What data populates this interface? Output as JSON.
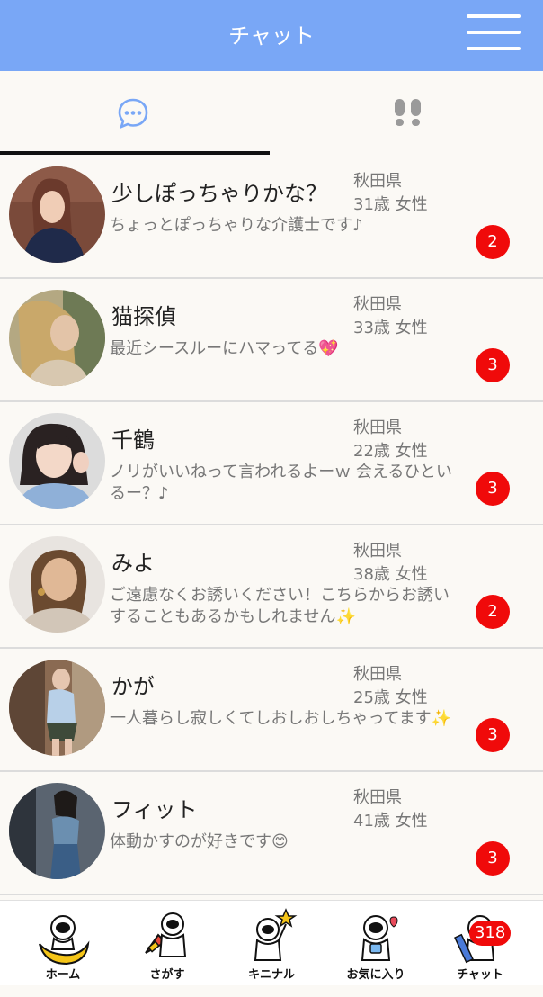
{
  "header": {
    "title": "チャット"
  },
  "tabs": [
    {
      "icon": "chat-bubble-icon"
    },
    {
      "icon": "footprints-icon"
    }
  ],
  "colors": {
    "header_bg": "#79a7f6",
    "badge": "#f00a0a",
    "tab_icon": "#79a7f6"
  },
  "chats": [
    {
      "name": "少しぽっちゃりかな？",
      "prefecture": "秋田県",
      "age_gender": "31歳 女性",
      "message": "ちょっとぽっちゃりな介護士です♪",
      "unread": "2"
    },
    {
      "name": "猫探偵",
      "prefecture": "秋田県",
      "age_gender": "33歳 女性",
      "message": "最近シースルーにハマってる💖",
      "unread": "3"
    },
    {
      "name": "千鶴",
      "prefecture": "秋田県",
      "age_gender": "22歳 女性",
      "message": "ノリがいいねって言われるよーｗ 会えるひといるー？♪",
      "unread": "3"
    },
    {
      "name": "みよ",
      "prefecture": "秋田県",
      "age_gender": "38歳 女性",
      "message": "ご遠慮なくお誘いください！こちらからお誘いすることもあるかもしれません✨",
      "unread": "2"
    },
    {
      "name": "かが",
      "prefecture": "秋田県",
      "age_gender": "25歳 女性",
      "message": "一人暮らし寂しくてしおしおしちゃってます✨",
      "unread": "3"
    },
    {
      "name": "フィット",
      "prefecture": "秋田県",
      "age_gender": "41歳 女性",
      "message": "体動かすのが好きです😊",
      "unread": "3"
    }
  ],
  "bottom_nav": [
    {
      "label": "ホーム",
      "icon": "astronaut-moon-icon"
    },
    {
      "label": "さがす",
      "icon": "astronaut-rocket-icon"
    },
    {
      "label": "キニナル",
      "icon": "astronaut-star-icon"
    },
    {
      "label": "お気に入り",
      "icon": "astronaut-heart-icon"
    },
    {
      "label": "チャット",
      "icon": "astronaut-pencil-icon",
      "badge": "318"
    }
  ]
}
